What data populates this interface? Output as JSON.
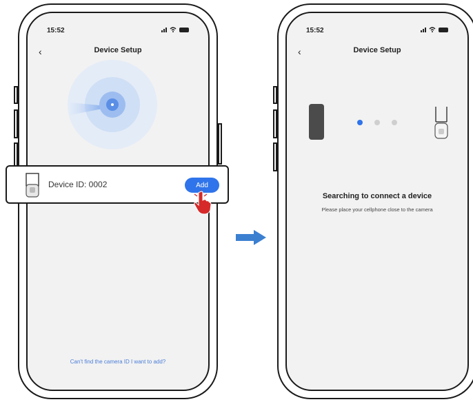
{
  "left_phone": {
    "status_time": "15:52",
    "nav_title": "Device Setup",
    "device_card": {
      "label": "Device ID:  0002",
      "add_button": "Add"
    },
    "help_link": "Can't find the camera ID I want to add?"
  },
  "right_phone": {
    "status_time": "15:52",
    "nav_title": "Device Setup",
    "search_title": "Searching to connect a device",
    "search_subtitle": "Please place your cellphone close to the camera",
    "progress_dots": [
      {
        "state": "active",
        "color": "#2f74ea"
      },
      {
        "state": "inactive",
        "color": "#cfcfcf"
      },
      {
        "state": "inactive",
        "color": "#cfcfcf"
      }
    ]
  },
  "icons": [
    "back-icon",
    "signal-icon",
    "wifi-icon",
    "battery-icon",
    "camera-icon",
    "hand-pointer-icon",
    "arrow-right-icon"
  ],
  "colors": {
    "accent": "#2f74ea",
    "arrow": "#3b7fd1",
    "pointer": "#d62a2a"
  }
}
